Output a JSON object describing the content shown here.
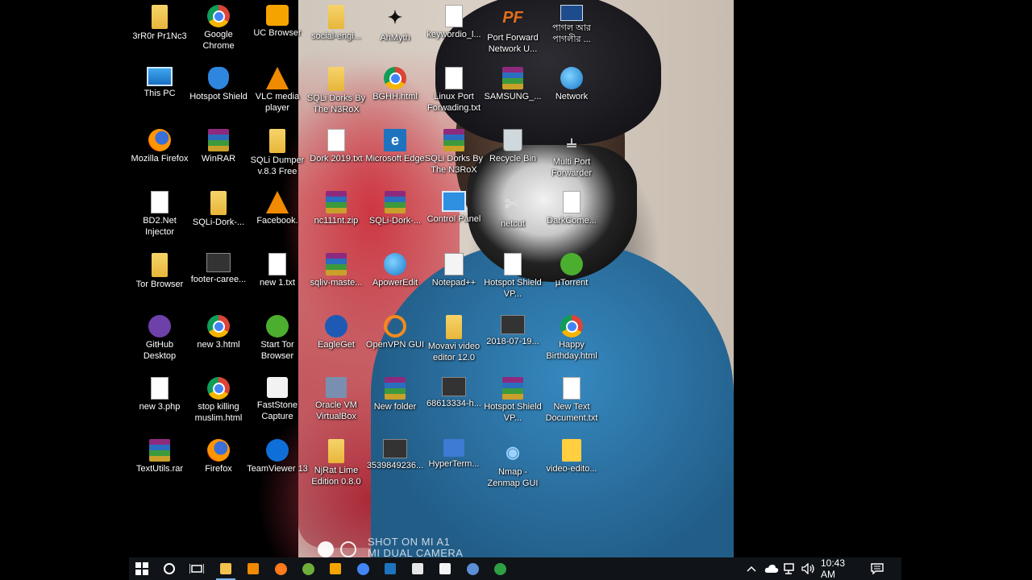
{
  "desktop": {
    "icons": [
      {
        "label": "3rR0r Pr1Nc3",
        "icon": "user-folder-icon"
      },
      {
        "label": "Google Chrome",
        "icon": "chrome-icon"
      },
      {
        "label": "UC Browser",
        "icon": "uc-browser-icon"
      },
      {
        "label": "social-engi...",
        "icon": "folder-icon"
      },
      {
        "label": "AhMyth",
        "icon": "ahmyth-icon"
      },
      {
        "label": "keywordio_l...",
        "icon": "document-icon"
      },
      {
        "label": "Port Forward Network U...",
        "icon": "portforward-icon"
      },
      {
        "label": "পাগল আর পাগলীর ...",
        "icon": "video-thumb-icon"
      },
      {
        "label": "This PC",
        "icon": "computer-icon"
      },
      {
        "label": "Hotspot Shield",
        "icon": "hotspot-shield-icon"
      },
      {
        "label": "VLC media player",
        "icon": "vlc-icon"
      },
      {
        "label": "SQLi Dorks By The N3RoX",
        "icon": "folder-icon"
      },
      {
        "label": "BGHH.html",
        "icon": "chrome-icon"
      },
      {
        "label": "Linux Port Forwading.txt",
        "icon": "document-icon"
      },
      {
        "label": "SAMSUNG_...",
        "icon": "winrar-icon"
      },
      {
        "label": "Network",
        "icon": "network-icon"
      },
      {
        "label": "Mozilla Firefox",
        "icon": "firefox-icon"
      },
      {
        "label": "WinRAR",
        "icon": "winrar-icon"
      },
      {
        "label": "SQLi Dumper v.8.3 Free",
        "icon": "folder-icon"
      },
      {
        "label": "Dork 2019.txt",
        "icon": "document-icon"
      },
      {
        "label": "Microsoft Edge",
        "icon": "edge-icon"
      },
      {
        "label": "SQLi Dorks By The N3RoX",
        "icon": "winrar-icon"
      },
      {
        "label": "Recycle Bin",
        "icon": "recycle-bin-icon"
      },
      {
        "label": "Multi Port Forwarder",
        "icon": "plug-icon"
      },
      {
        "label": "BD2.Net Injector",
        "icon": "document-icon"
      },
      {
        "label": "SQLi-Dork-...",
        "icon": "folder-icon"
      },
      {
        "label": "Facebook.",
        "icon": "vlc-icon"
      },
      {
        "label": "nc111nt.zip",
        "icon": "winrar-icon"
      },
      {
        "label": "SQLi-Dork-...",
        "icon": "winrar-icon"
      },
      {
        "label": "Control Panel",
        "icon": "control-panel-icon"
      },
      {
        "label": "netcut",
        "icon": "scissors-icon"
      },
      {
        "label": "DarkCome...",
        "icon": "document-icon"
      },
      {
        "label": "Tor Browser",
        "icon": "folder-icon"
      },
      {
        "label": "footer-caree...",
        "icon": "image-icon"
      },
      {
        "label": "new 1.txt",
        "icon": "document-icon"
      },
      {
        "label": "sqliv-maste...",
        "icon": "winrar-icon"
      },
      {
        "label": "ApowerEdit",
        "icon": "apoweredit-icon"
      },
      {
        "label": "Notepad++",
        "icon": "notepad-icon"
      },
      {
        "label": "Hotspot Shield VP...",
        "icon": "document-icon"
      },
      {
        "label": "µTorrent",
        "icon": "utorrent-icon"
      },
      {
        "label": "GitHub Desktop",
        "icon": "github-icon"
      },
      {
        "label": "new 3.html",
        "icon": "chrome-icon"
      },
      {
        "label": "Start Tor Browser",
        "icon": "tor-icon"
      },
      {
        "label": "EagleGet",
        "icon": "eagleget-icon"
      },
      {
        "label": "OpenVPN GUI",
        "icon": "openvpn-icon"
      },
      {
        "label": "Movavi video editor 12.0",
        "icon": "folder-icon"
      },
      {
        "label": "2018-07-19...",
        "icon": "image-icon"
      },
      {
        "label": "Happy Birthday.html",
        "icon": "chrome-icon"
      },
      {
        "label": "new 3.php",
        "icon": "document-icon"
      },
      {
        "label": "stop killing muslim.html",
        "icon": "chrome-icon"
      },
      {
        "label": "FastStone Capture",
        "icon": "faststone-icon"
      },
      {
        "label": "Oracle VM VirtualBox",
        "icon": "virtualbox-icon"
      },
      {
        "label": "New folder",
        "icon": "winrar-icon"
      },
      {
        "label": "68613334-h...",
        "icon": "image-icon"
      },
      {
        "label": "Hotspot Shield VP...",
        "icon": "winrar-icon"
      },
      {
        "label": "New Text Document.txt",
        "icon": "document-icon"
      },
      {
        "label": "TextUtils.rar",
        "icon": "winrar-icon"
      },
      {
        "label": "Firefox",
        "icon": "firefox-icon"
      },
      {
        "label": "TeamViewer 13",
        "icon": "teamviewer-icon"
      },
      {
        "label": "NjRat Lime Edition 0.8.0",
        "icon": "folder-icon"
      },
      {
        "label": "3539849236...",
        "icon": "photo-icon"
      },
      {
        "label": "HyperTerm...",
        "icon": "hyperterminal-icon"
      },
      {
        "label": "Nmap - Zenmap GUI",
        "icon": "nmap-icon"
      },
      {
        "label": "video-edito...",
        "icon": "video-editor-icon"
      }
    ],
    "watermark_line1": "SHOT ON MI A1",
    "watermark_line2": "MI DUAL CAMERA"
  },
  "taskbar": {
    "start": "windows-start-icon",
    "search": "cortana-icon",
    "taskview": "task-view-icon",
    "apps": [
      "file-explorer-icon",
      "vlc-icon",
      "firefox-icon",
      "tor-icon",
      "uc-browser-icon",
      "chrome-icon",
      "edge-icon",
      "store-icon",
      "mail-icon",
      "browser-icon",
      "chat-icon"
    ],
    "clock": "10:43 AM"
  }
}
